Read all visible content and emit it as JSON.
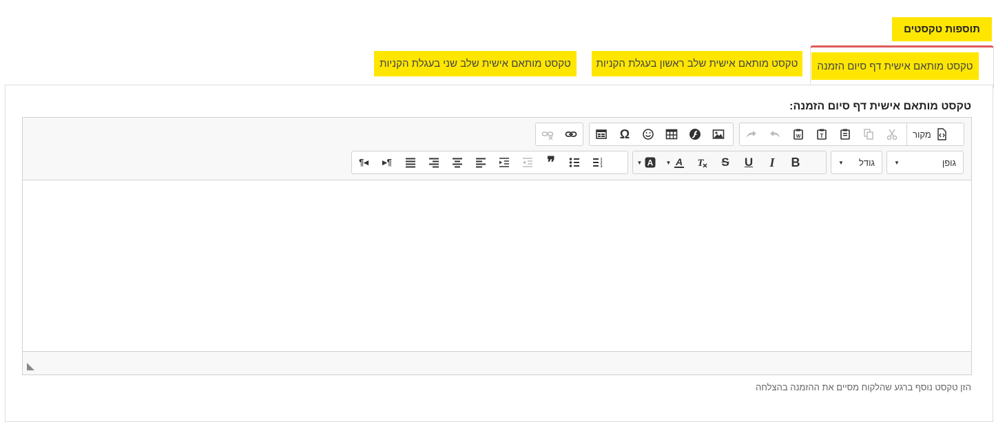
{
  "section": {
    "title": "תוספות טקסטים"
  },
  "tabs": [
    {
      "label": "טקסט מותאם אישית דף סיום הזמנה",
      "active": true
    },
    {
      "label": "טקסט מותאם אישית שלב ראשון בעגלת הקניות",
      "active": false
    },
    {
      "label": "טקסט מותאם אישית שלב שני בעגלת הקניות",
      "active": false
    }
  ],
  "field": {
    "label": "טקסט מותאם אישית דף סיום הזמנה:"
  },
  "toolbar": {
    "source_label": "מקור",
    "font_label": "גופן",
    "size_label": "גודל",
    "bold_glyph": "B",
    "italic_glyph": "I",
    "underline_glyph": "U",
    "strike_glyph": "S",
    "omega_glyph": "Ω",
    "quote_glyph": "❞",
    "ltr_glyph": "¶◂",
    "rtl_glyph": "▸¶"
  },
  "help": {
    "text": "הזן טקסט נוסף ברגע שהלקוח מסיים את ההזמנה בהצלחה"
  },
  "colors": {
    "highlight": "#ffe600",
    "active_tab_border": "#e05a5a"
  }
}
